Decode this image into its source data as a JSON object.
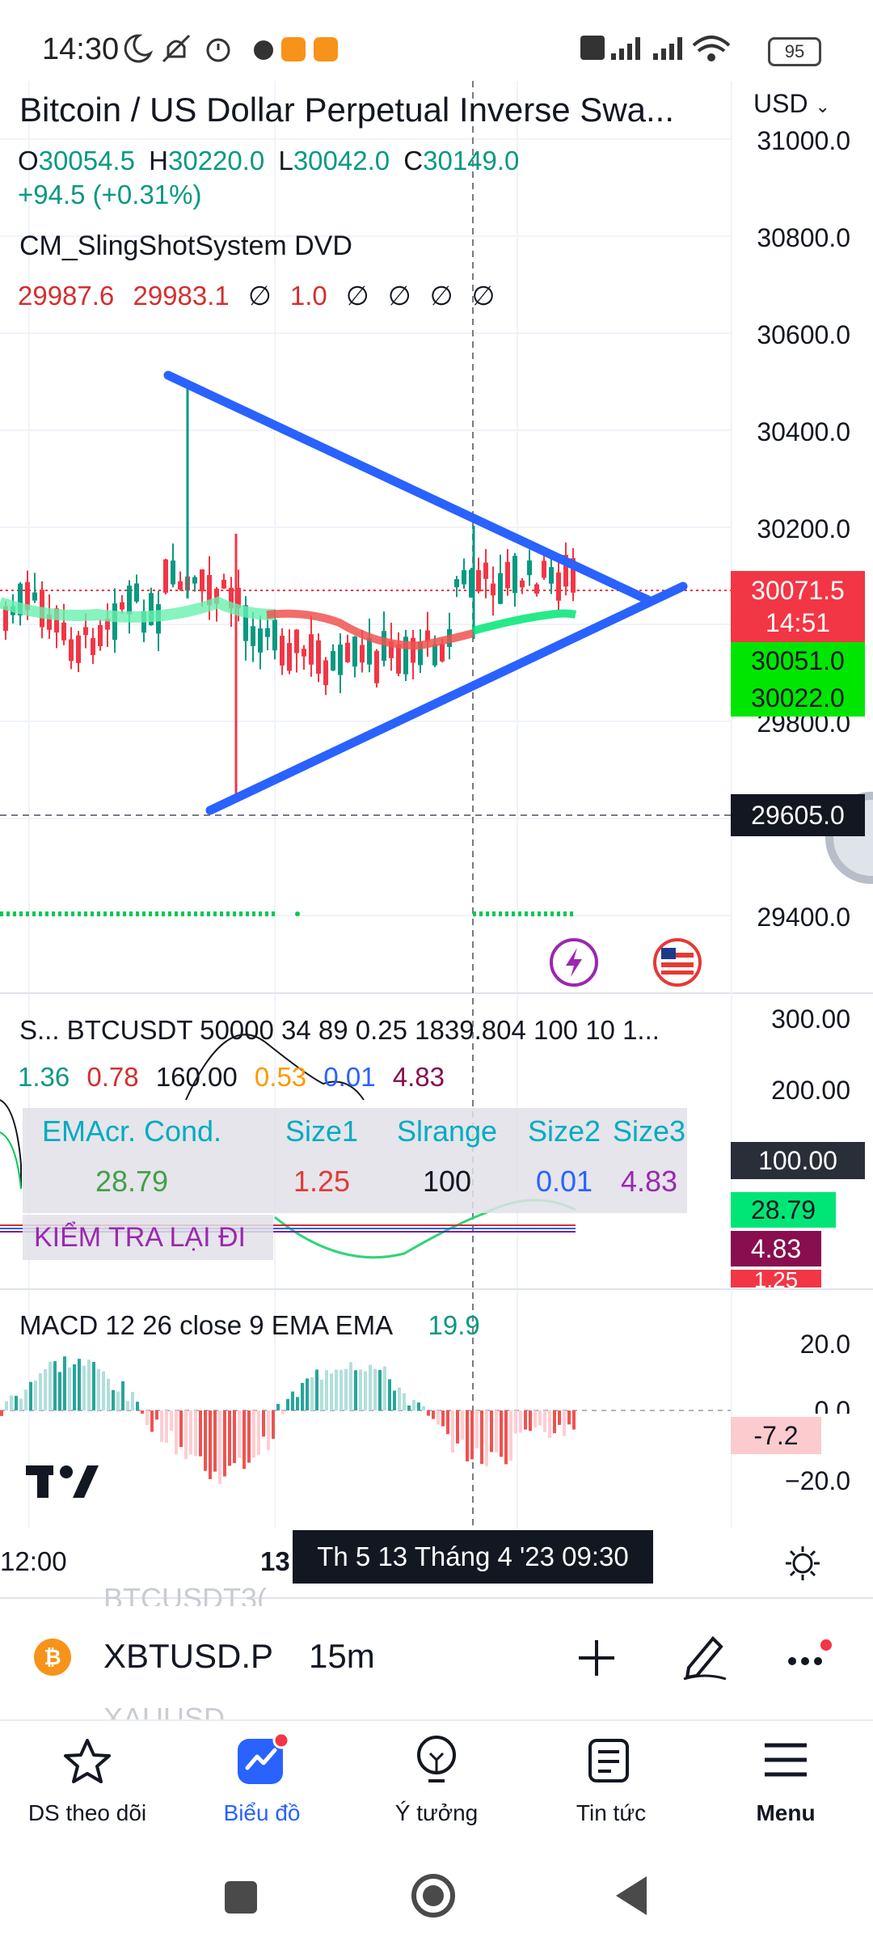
{
  "status_bar": {
    "time": "14:30",
    "battery": "95",
    "icons": [
      "moon-icon",
      "mute-icon",
      "alarm-icon",
      "record-icon",
      "app-icon",
      "app-icon",
      "volte-icon",
      "signal-icon",
      "signal-icon",
      "wifi-icon",
      "battery-icon"
    ]
  },
  "header": {
    "title": "Bitcoin / US Dollar Perpetual Inverse Swa...",
    "currency": "USD",
    "ohlc": {
      "o_key": "O",
      "o": "30054.5",
      "h_key": "H",
      "h": "30220.0",
      "l_key": "L",
      "l": "30042.0",
      "c_key": "C",
      "c": "30149.0"
    },
    "change": "+94.5 (+0.31%)"
  },
  "indicator1": {
    "name": "CM_SlingShotSystem DVD",
    "v1": "29987.6",
    "v2": "29983.1",
    "v3": "1.0",
    "empty": "∅"
  },
  "price_axis": {
    "ticks": [
      "31000.0",
      "30800.0",
      "30600.0",
      "30400.0",
      "30200.0",
      "29800.0",
      "29400.0"
    ],
    "badges": {
      "current_price": "30071.5",
      "countdown": "14:51",
      "ema_fast": "30051.0",
      "ema_slow": "30022.0",
      "crosshair": "29605.0"
    }
  },
  "stoch_panel": {
    "label": "S... BTCUSDT 50000 34 89 0.25 1839.804 100 10 1...",
    "values": [
      "1.36",
      "0.78",
      "160.00",
      "0.53",
      "0.01",
      "4.83"
    ],
    "axis": [
      "300.00",
      "200.00",
      "100.00"
    ],
    "badges": [
      "28.79",
      "4.83",
      "1.25"
    ],
    "table": {
      "headers": [
        "EMAcr. Cond.",
        "Size1",
        "Slrange",
        "Size2",
        "Size3"
      ],
      "values": [
        "28.79",
        "1.25",
        "100",
        "0.01",
        "4.83"
      ]
    },
    "warning": "KIỂM TRA LẠI ĐI"
  },
  "macd_panel": {
    "label": "MACD 12 26 close 9 EMA EMA",
    "value": "19.9",
    "axis": [
      "20.0",
      "0.0",
      "−20.0"
    ],
    "badge": "-7.2"
  },
  "time_axis": {
    "labels": [
      "12:00",
      "13"
    ],
    "crosshair_time": "Th 5 13 Tháng 4 '23   09:30"
  },
  "symbol_bar": {
    "ghost_top": "BTCUSDT3(",
    "symbol": "XBTUSD.P",
    "timeframe": "15m",
    "ghost_bottom": "XAUUSD"
  },
  "bottom_nav": {
    "items": [
      {
        "label": "DS theo dõi",
        "icon": "star-icon"
      },
      {
        "label": "Biểu đồ",
        "icon": "chart-icon"
      },
      {
        "label": "Ý tưởng",
        "icon": "bulb-icon"
      },
      {
        "label": "Tin tức",
        "icon": "news-icon"
      },
      {
        "label": "Menu",
        "icon": "menu-icon"
      }
    ],
    "active": "Biểu đồ"
  },
  "colors": {
    "up": "#089981",
    "down": "#f23645",
    "trendline": "#2962ff",
    "ema_green": "#00e676",
    "accent_blue": "#2962ff",
    "purple": "#9c27b0",
    "dark_badge": "#131722"
  }
}
